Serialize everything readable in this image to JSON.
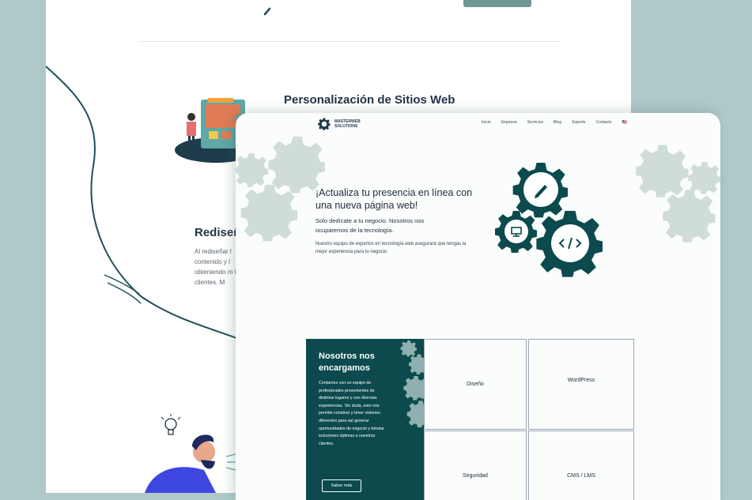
{
  "back_page": {
    "section_title": "Personalización de Sitios Web",
    "section2_title": "Rediseñ",
    "section2_text": "Al rediseñar l contenido y l obteniendo m los clientes. M"
  },
  "front_page": {
    "logo": {
      "line1": "MASTERWEB",
      "line2": "SOLUTIONS"
    },
    "nav": [
      "Inicio",
      "Empresa",
      "Servicios",
      "Blog",
      "Soporte",
      "Contacto",
      "🇺🇸"
    ],
    "hero": {
      "title": "¡Actualiza tu presencia en línea con una nueva página web!",
      "subtitle": "Solo dedícate a tu negocio. Nosotros nos ocuparemos de la tecnología.",
      "description": "Nuestro equipo de expertos en tecnología web asegurará que tengas la mejor experiencia para tu negocio."
    },
    "about": {
      "title": "Nosotros nos encargamos",
      "text": "Contamos con un equipo de profesionales provenientes de distintos lugares y con diversas experiencias. Sin duda, esto nos permite construir y tener visiones diferentes para así generar oportunidades de negocio y brindar soluciones óptimas a nuestros clientes.",
      "button": "Saber más"
    },
    "services": [
      "Diseño",
      "WordPress",
      "Seguridad",
      "CMS / LMS"
    ]
  },
  "colors": {
    "background": "#aec9c8",
    "dark_teal": "#0c4a4e",
    "gear_light": "#cfdcda",
    "navy_text": "#1e2d3a"
  },
  "icons": [
    "pencil-icon",
    "monitor-icon",
    "code-icon",
    "flag-us-icon",
    "lightbulb-icon"
  ]
}
